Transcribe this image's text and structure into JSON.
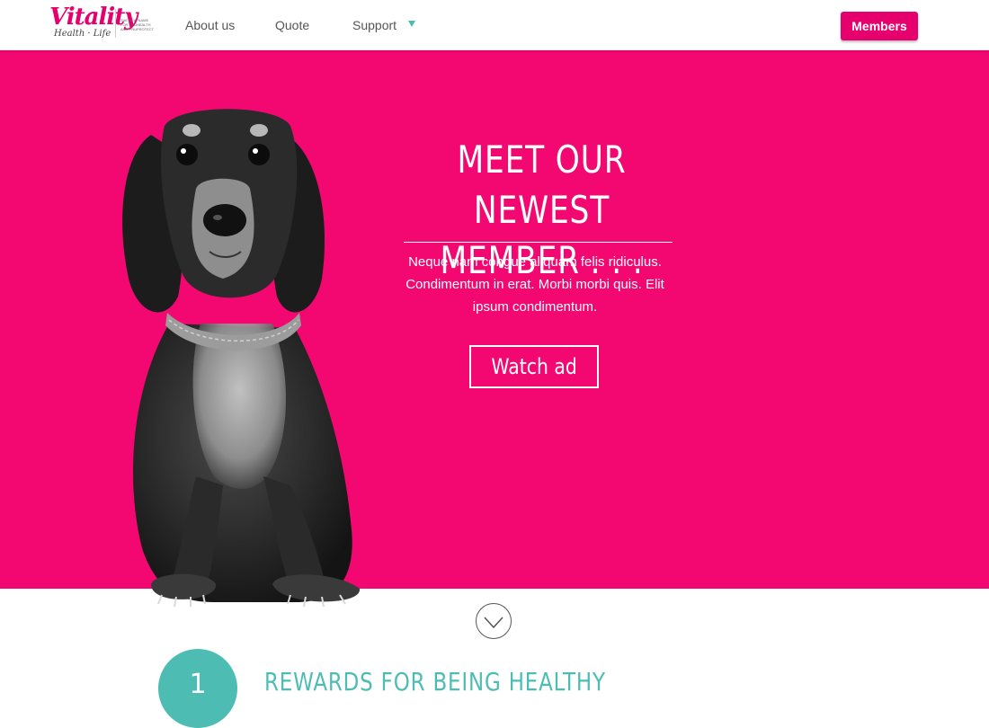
{
  "header": {
    "logo": {
      "name": "Vitality",
      "sub": "Health · Life",
      "tagline": "THE NEW NAME FOR PRUHEALTH AND PRUPROTECT"
    },
    "nav": [
      {
        "label": "About us"
      },
      {
        "label": "Quote"
      },
      {
        "label": "Support"
      }
    ],
    "members_label": "Members"
  },
  "hero": {
    "title_line1": "MEET OUR NEWEST",
    "title_line2": "MEMBER . . .",
    "body": "Neque nam congue aliquam felis ridiculus. Condimentum in erat. Morbi morbi quis. Elit ipsum condimentum.",
    "button_label": "Watch ad",
    "background_color": "#f20870"
  },
  "section": {
    "step_number": "1",
    "heading": "REWARDS FOR BEING HEALTHY"
  },
  "colors": {
    "brand_pink": "#e6006e",
    "teal": "#4dbdb4"
  },
  "icons": {
    "scroll": "chevron-down-circle-icon",
    "support_caret": "caret-down-icon"
  }
}
